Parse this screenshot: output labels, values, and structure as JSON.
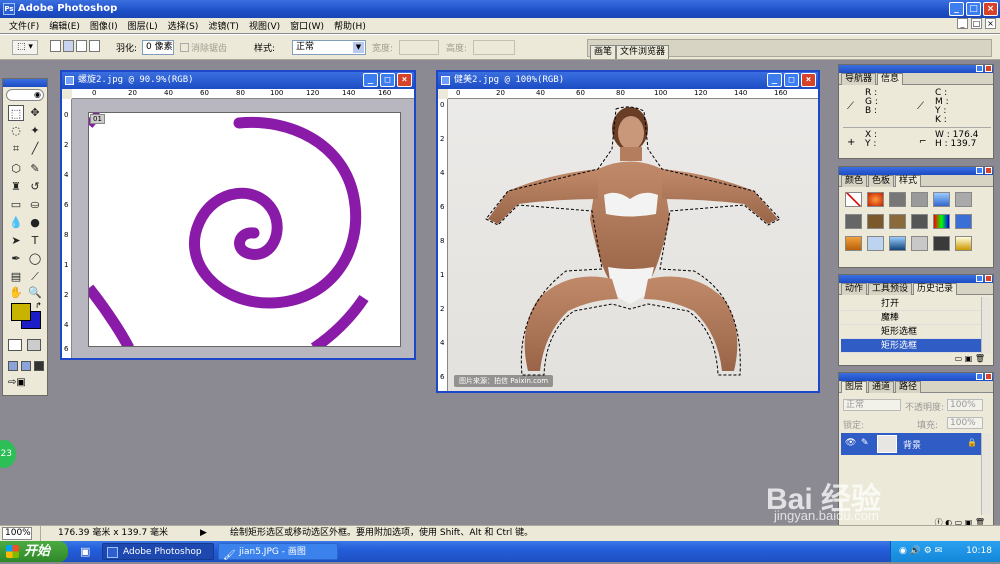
{
  "app": {
    "title": "Adobe Photoshop"
  },
  "menu": [
    "文件(F)",
    "编辑(E)",
    "图像(I)",
    "图层(L)",
    "选择(S)",
    "滤镜(T)",
    "视图(V)",
    "窗口(W)",
    "帮助(H)"
  ],
  "options": {
    "feather_label": "羽化:",
    "feather_value": "0 像素",
    "antialias_label": "消除锯齿",
    "style_label": "样式:",
    "style_value": "正常",
    "width_label": "宽度:",
    "height_label": "高度:",
    "well_tabs": [
      "画笔",
      "文件浏览器"
    ]
  },
  "doc1": {
    "title": "螺旋2.jpg @ 90.9%(RGB)",
    "ruler_h": [
      "0",
      "20",
      "40",
      "60",
      "80",
      "100",
      "120",
      "140",
      "160"
    ],
    "ruler_v": [
      "0",
      "2",
      "4",
      "6",
      "8",
      "1",
      "2",
      "4",
      "6"
    ],
    "badge": "01"
  },
  "doc2": {
    "title": "健美2.jpg @ 100%(RGB)",
    "ruler_h": [
      "0",
      "20",
      "40",
      "60",
      "80",
      "100",
      "120",
      "140",
      "160"
    ],
    "ruler_v": [
      "0",
      "2",
      "4",
      "6",
      "8",
      "1",
      "2",
      "4",
      "6"
    ],
    "watermark": "图片来源：拍信 Paixin.com"
  },
  "navigator": {
    "tabs": [
      "导航器",
      "信息"
    ],
    "rgb": [
      "R :",
      "G :",
      "B :"
    ],
    "cmyk": [
      "C :",
      "M :",
      "Y :",
      "K :"
    ],
    "xy": [
      "X :",
      "Y :"
    ],
    "w_label": "W :",
    "w_value": "176.4",
    "h_label": "H :",
    "h_value": "139.7"
  },
  "swatches": {
    "tabs": [
      "颜色",
      "色板",
      "样式"
    ]
  },
  "history": {
    "tabs": [
      "动作",
      "工具预设",
      "历史记录"
    ],
    "items": [
      "打开",
      "魔棒",
      "矩形选框",
      "矩形选框"
    ]
  },
  "layers": {
    "tabs": [
      "图层",
      "通道",
      "路径"
    ],
    "blend_mode": "正常",
    "opacity_label": "不透明度:",
    "opacity_value": "100%",
    "lock_label": "锁定:",
    "fill_label": "填充:",
    "fill_value": "100%",
    "layer_name": "背景"
  },
  "status": {
    "zoom": "100%",
    "size": "176.39 毫米 x 139.7 毫米",
    "hint": "绘制矩形选区或移动选区外框。要用附加选项，使用 Shift、Alt 和 Ctrl 键。"
  },
  "taskbar": {
    "start": "开始",
    "tasks": [
      "Adobe Photoshop",
      "jian5.JPG - 画图"
    ],
    "clock": "10:18"
  },
  "overlay": {
    "bubble": "23",
    "brand": "Bai 经验",
    "url": "jingyan.baidu.com"
  },
  "colors": {
    "foreground": "#c8b400",
    "background": "#1c1cc8",
    "spiral": "#8a1aa8"
  }
}
